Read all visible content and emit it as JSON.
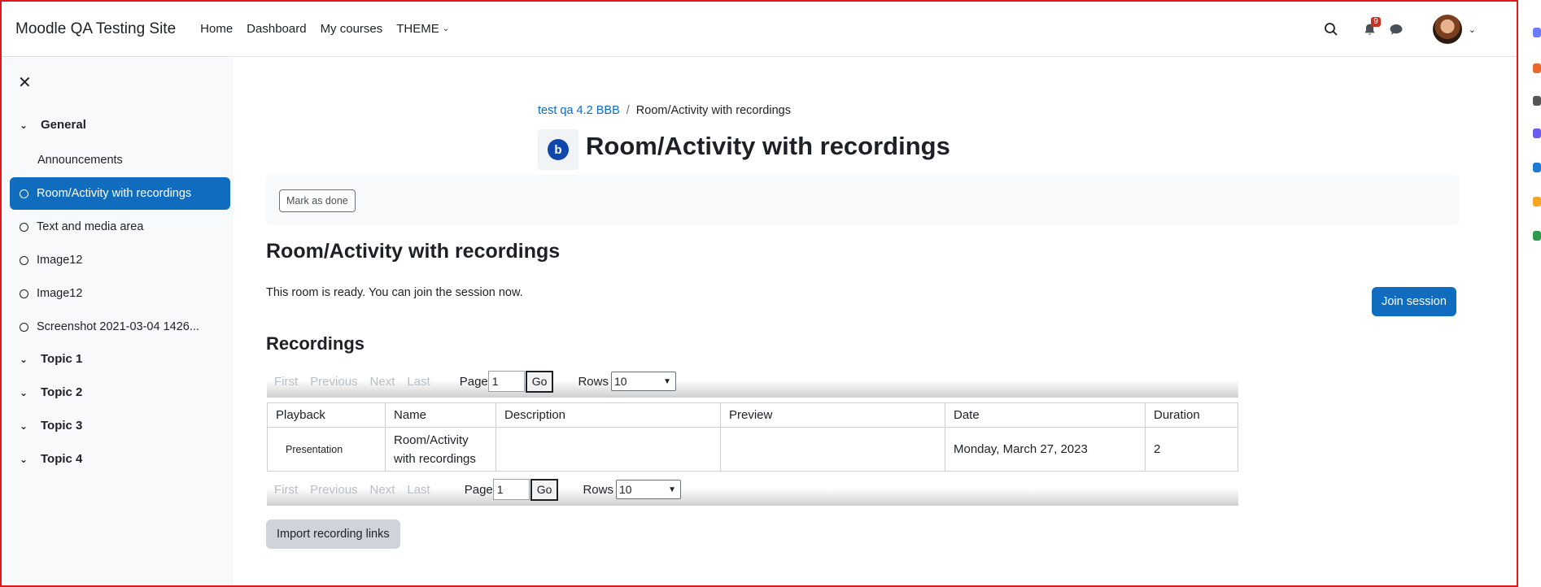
{
  "navbar": {
    "site_name": "Moodle QA Testing Site",
    "links": [
      "Home",
      "Dashboard",
      "My courses",
      "THEME"
    ],
    "notification_count": "9"
  },
  "drawer": {
    "sections": [
      {
        "label": "General"
      },
      {
        "label": "Topic 1"
      },
      {
        "label": "Topic 2"
      },
      {
        "label": "Topic 3"
      },
      {
        "label": "Topic 4"
      }
    ],
    "items": [
      {
        "label": "Announcements"
      },
      {
        "label": "Room/Activity with recordings"
      },
      {
        "label": "Text and media area"
      },
      {
        "label": "Image12"
      },
      {
        "label": "Image12"
      },
      {
        "label": "Screenshot 2021-03-04 1426..."
      }
    ]
  },
  "breadcrumb": {
    "course": "test qa 4.2 BBB",
    "separator": "/",
    "current": "Room/Activity with recordings"
  },
  "header": {
    "icon_letter": "b",
    "title": "Room/Activity with recordings"
  },
  "completion": {
    "mark_label": "Mark as done"
  },
  "room": {
    "title": "Room/Activity with recordings",
    "status": "This room is ready. You can join the session now.",
    "join_label": "Join session"
  },
  "recordings": {
    "title": "Recordings",
    "pager": {
      "first": "First",
      "previous": "Previous",
      "next": "Next",
      "last": "Last",
      "page_label": "Page",
      "page_value": "1",
      "go": "Go",
      "rows_label": "Rows",
      "rows_value": "10"
    },
    "columns": [
      "Playback",
      "Name",
      "Description",
      "Preview",
      "Date",
      "Duration"
    ],
    "rows": [
      {
        "playback": "Presentation",
        "name_line1": "Room/Activity",
        "name_line2": "with recordings",
        "description": "",
        "preview": "",
        "date": "Monday, March 27, 2023",
        "duration": "2"
      }
    ],
    "import_label": "Import recording links"
  },
  "colors": {
    "primary": "#0f6cbf",
    "frame_border": "#e0191e",
    "drawer_bg": "#f8f9fa"
  }
}
